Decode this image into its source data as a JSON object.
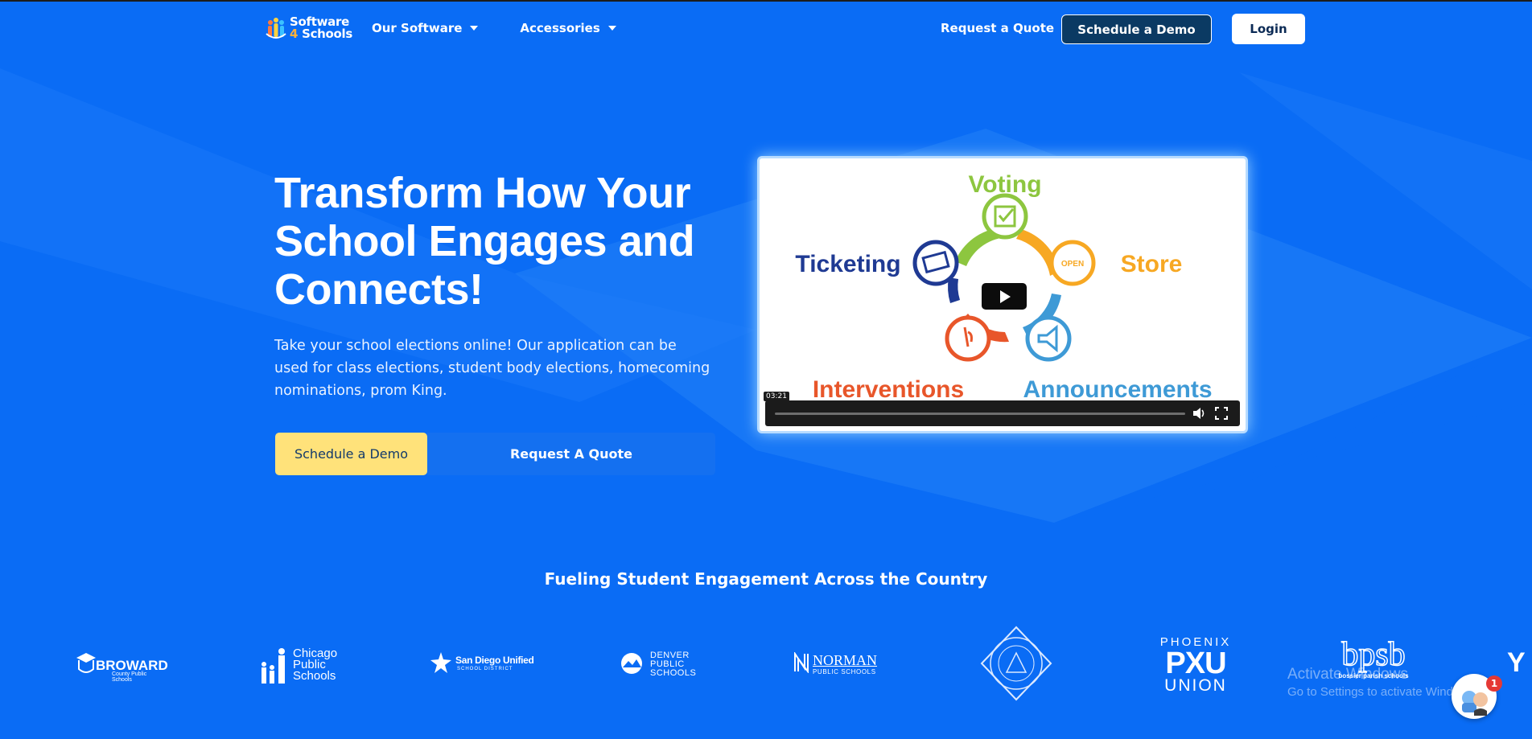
{
  "brand": {
    "line1": "Software",
    "line2_num": "4",
    "line2_word": "Schools"
  },
  "nav": {
    "items": [
      {
        "label": "Our Software"
      },
      {
        "label": "Accessories"
      }
    ],
    "request_quote": "Request a Quote",
    "schedule_demo": "Schedule a Demo",
    "login": "Login"
  },
  "hero": {
    "title": "Transform How Your School Engages and Connects!",
    "description": "Take your school elections online! Our application can be used for class elections, student body elections, homecoming nominations, prom King.",
    "primary_cta": "Schedule a Demo",
    "secondary_cta": "Request A Quote"
  },
  "video": {
    "labels": {
      "voting": "Voting",
      "store": "Store",
      "ticketing": "Ticketing",
      "interventions": "Interventions",
      "announcements": "Announcements",
      "open_sign": "OPEN"
    },
    "duration": "03:21"
  },
  "partners": {
    "heading": "Fueling Student Engagement Across the Country",
    "broward": {
      "name": "BROWARD",
      "sub": "County Public Schools"
    },
    "chicago": {
      "l1": "Chicago",
      "l2": "Public",
      "l3": "Schools"
    },
    "sandiego": {
      "l1": "San Diego Unified",
      "l2": "SCHOOL DISTRICT"
    },
    "denver": {
      "l1": "DENVER",
      "l2": "PUBLIC",
      "l3": "SCHOOLS"
    },
    "norman": {
      "l1": "NORMAN",
      "l2": "PUBLIC SCHOOLS"
    },
    "phoenix": {
      "l1": "PHOENIX",
      "l2": "PXU",
      "l3": "UNION"
    },
    "bossier": {
      "l1": "bpsb",
      "l2": "bossier parish schools"
    },
    "cutoff": "Y"
  },
  "windows_watermark": {
    "line1": "Activate Windows",
    "line2": "Go to Settings to activate Windows."
  },
  "chat": {
    "badge": "1"
  },
  "colors": {
    "background": "#0a6cf5",
    "demo_top": "#0b3a63",
    "cta_yellow": "#ffe27a",
    "voting": "#8dc63f",
    "store": "#f7a823",
    "ticketing": "#1f3a93",
    "interventions": "#e8562a",
    "announcements": "#3e9ad6"
  }
}
